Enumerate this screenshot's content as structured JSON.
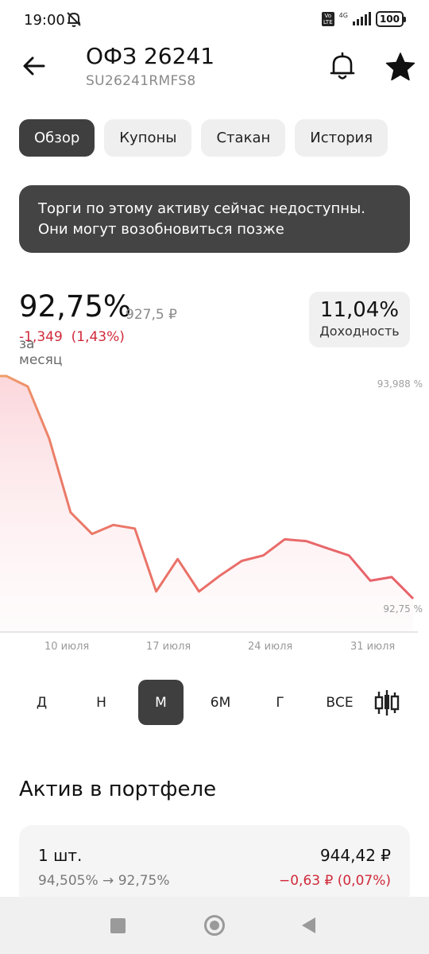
{
  "status_bar": {
    "time": "19:00",
    "volte": "Vo\nLTE",
    "network": "4G",
    "battery": "100",
    "icons": [
      "bell-off-icon",
      "signal-icon",
      "battery-icon"
    ]
  },
  "header": {
    "title": "ОФЗ 26241",
    "isin": "SU26241RMFS8",
    "icons": [
      "back-arrow-icon",
      "bell-icon",
      "star-icon"
    ]
  },
  "tabs": [
    {
      "label": "Обзор",
      "active": true
    },
    {
      "label": "Купоны",
      "active": false
    },
    {
      "label": "Стакан",
      "active": false
    },
    {
      "label": "История",
      "active": false
    }
  ],
  "notice": {
    "line1": "Торги по этому активу сейчас недоступны.",
    "line2": "Они могут возобновиться позже"
  },
  "quote": {
    "price_percent": "92,75%",
    "price_rub": "927,5 ₽",
    "change_abs": "-1,349",
    "change_pct": "(1,43%)",
    "change_period": "за месяц",
    "yield_value": "11,04%",
    "yield_label": "Доходность"
  },
  "chart_data": {
    "type": "area",
    "y_unit": "%",
    "max_label": "93,988 %",
    "current_label": "92,75 %",
    "x_labels": [
      "10 июля",
      "17 июля",
      "24 июля",
      "31 июля"
    ],
    "values": [
      93.988,
      93.93,
      93.64,
      93.23,
      93.11,
      93.16,
      93.14,
      92.79,
      92.97,
      92.79,
      92.88,
      92.96,
      92.99,
      93.08,
      93.07,
      93.03,
      92.99,
      92.85,
      92.87,
      92.75
    ],
    "ylim": [
      92.75,
      93.988
    ],
    "colors": {
      "line": "#e8616a",
      "line_start": "#f0a06a",
      "fill": "#fde8ea"
    }
  },
  "periods": [
    {
      "label": "Д",
      "active": false
    },
    {
      "label": "Н",
      "active": false
    },
    {
      "label": "М",
      "active": true
    },
    {
      "label": "6М",
      "active": false
    },
    {
      "label": "Г",
      "active": false
    },
    {
      "label": "ВСЕ",
      "active": false
    }
  ],
  "portfolio": {
    "section_title": "Актив в портфеле",
    "quantity": "1 шт.",
    "total": "944,42 ₽",
    "price_range": "94,505% → 92,75%",
    "pnl": "−0,63 ₽ (0,07%)"
  },
  "colors": {
    "accent_dark": "#3f3f3f",
    "negative": "#d02a3a",
    "muted": "#8a8a8a"
  }
}
